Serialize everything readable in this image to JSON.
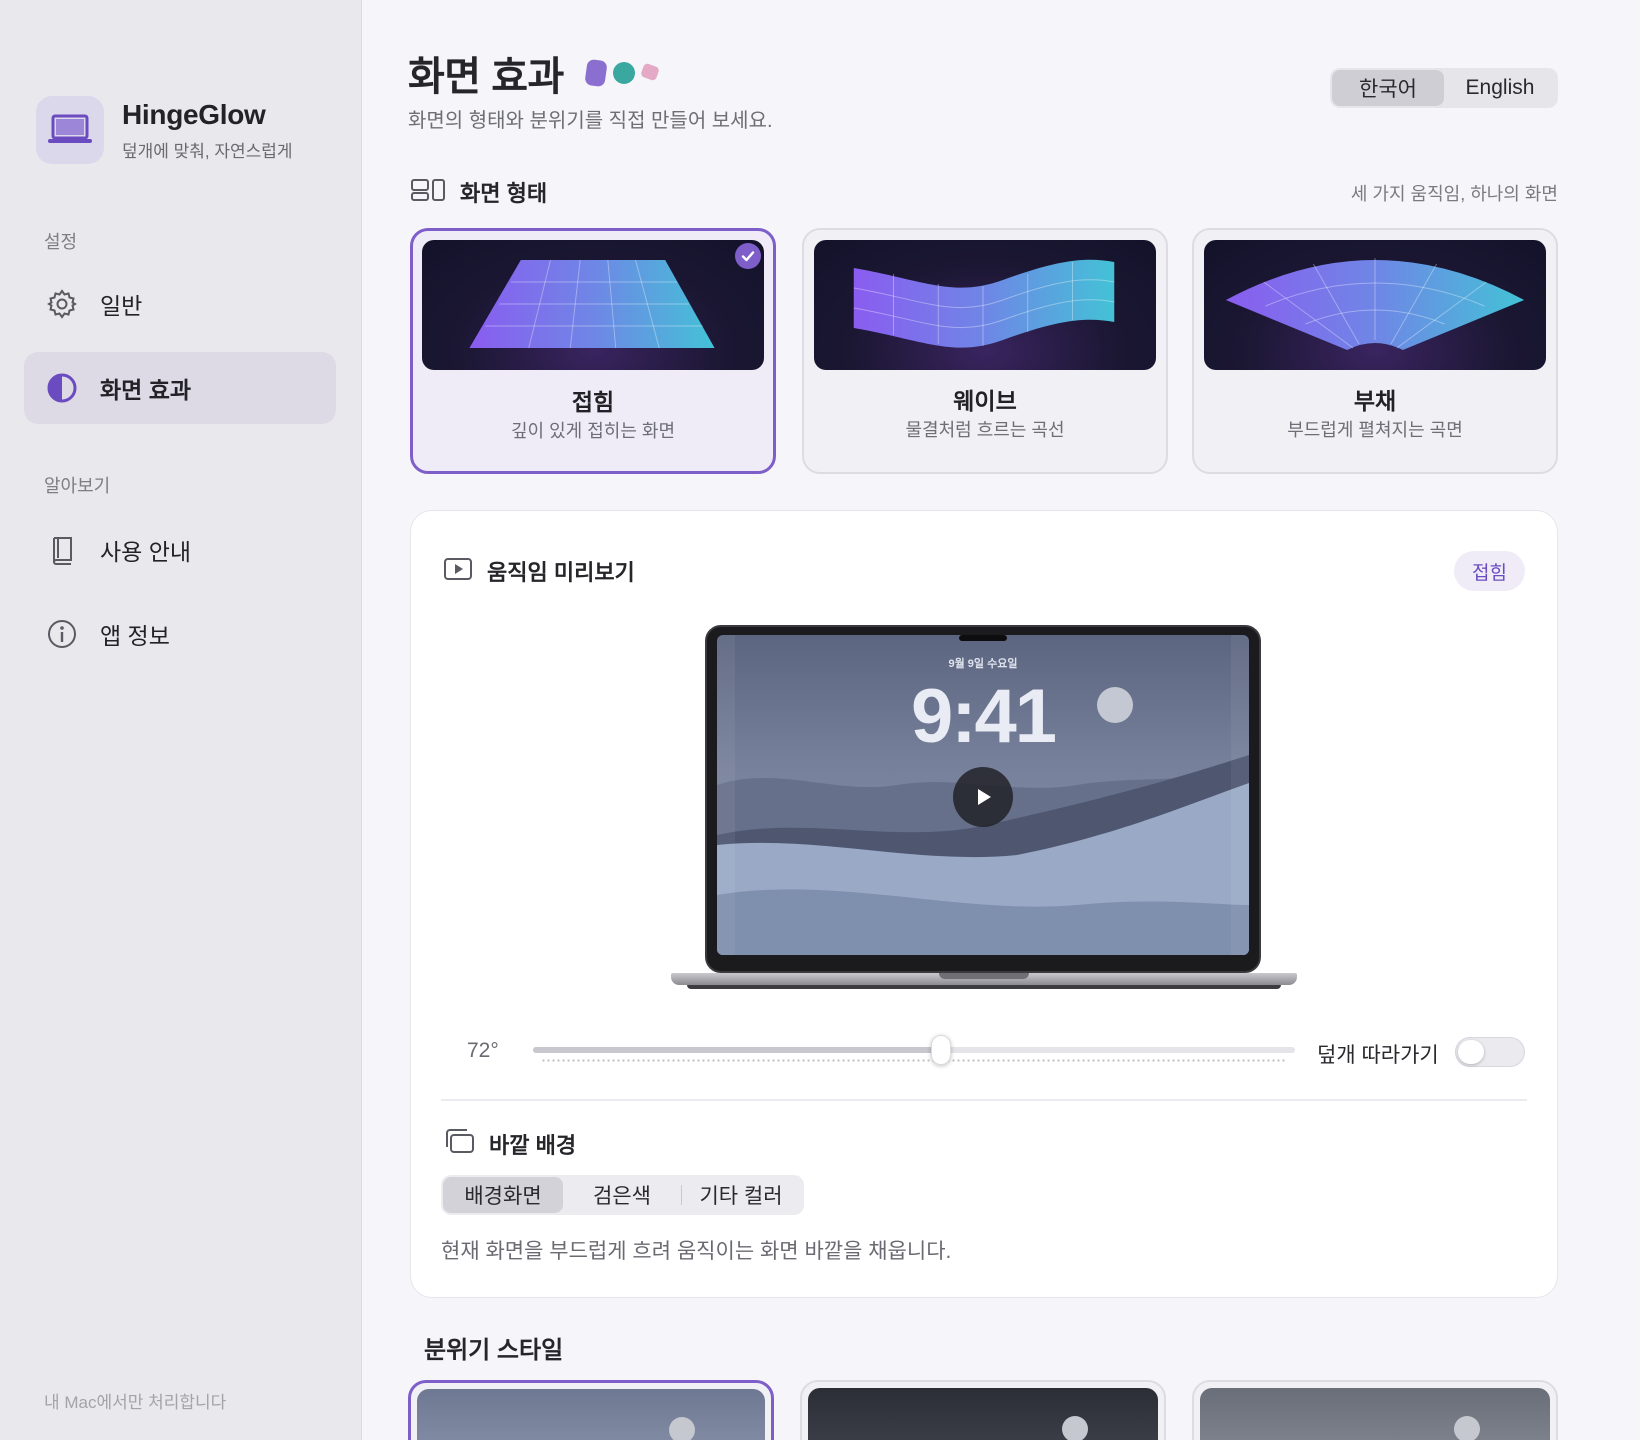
{
  "app": {
    "name": "HingeGlow",
    "tagline": "덮개에 맞춰, 자연스럽게"
  },
  "sidebar": {
    "section_settings": "설정",
    "section_learn": "알아보기",
    "items": [
      {
        "label": "일반",
        "icon": "gear-icon"
      },
      {
        "label": "화면 효과",
        "icon": "contrast-icon",
        "active": true
      },
      {
        "label": "사용 안내",
        "icon": "book-icon"
      },
      {
        "label": "앱 정보",
        "icon": "info-icon"
      }
    ],
    "footer": "내 Mac에서만 처리합니다"
  },
  "header": {
    "title": "화면 효과",
    "subtitle": "화면의 형태와 분위기를 직접 만들어 보세요.",
    "languages": [
      "한국어",
      "English"
    ],
    "selected_language": "한국어"
  },
  "shape": {
    "title": "화면 형태",
    "note": "세 가지 움직임, 하나의 화면",
    "cards": [
      {
        "name": "접힘",
        "desc": "깊이 있게 접히는 화면",
        "selected": true
      },
      {
        "name": "웨이브",
        "desc": "물결처럼 흐르는 곡선",
        "selected": false
      },
      {
        "name": "부채",
        "desc": "부드럽게 펼쳐지는 곡면",
        "selected": false
      }
    ]
  },
  "preview": {
    "title": "움직임 미리보기",
    "badge": "접힘",
    "screen_date": "9월 9일 수요일",
    "screen_time": "9:41",
    "angle_label": "72°",
    "angle_fraction": 0.535,
    "follow_lid_label": "덮개 따라가기",
    "follow_lid_on": false
  },
  "outer_bg": {
    "title": "바깥 배경",
    "options": [
      "배경화면",
      "검은색",
      "기타 컬러"
    ],
    "selected": "배경화면",
    "description": "현재 화면을 부드럽게 흐려 움직이는 화면 바깥을 채웁니다."
  },
  "mood": {
    "title": "분위기 스타일"
  },
  "colors": {
    "accent": "#7e5fc9",
    "sidebar_bg": "#e9e8ec",
    "main_bg": "#f6f5f9"
  }
}
